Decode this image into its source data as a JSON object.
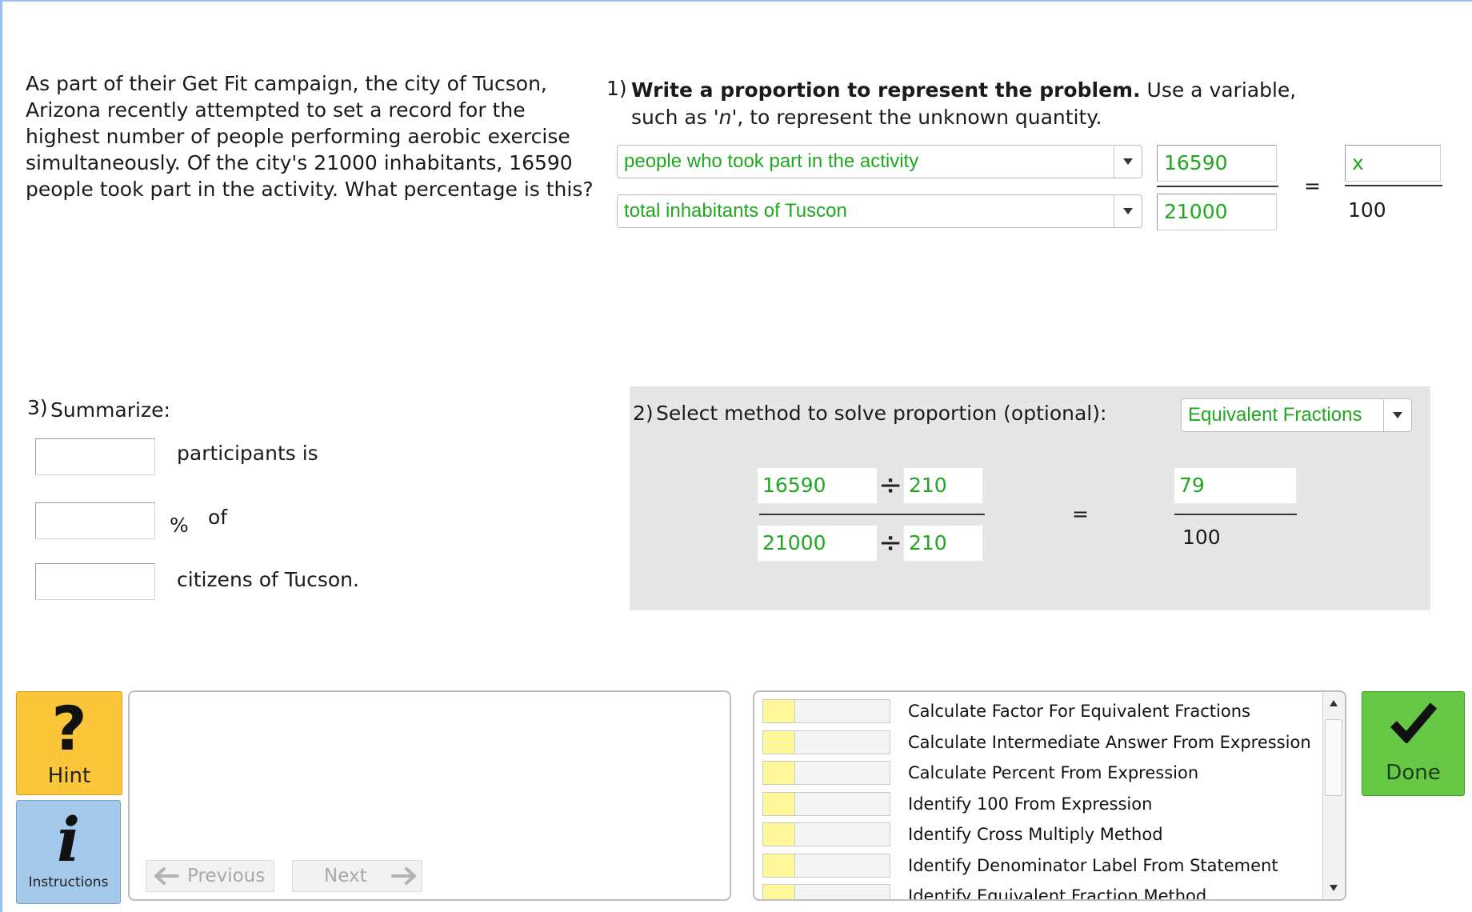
{
  "problem": {
    "text": "As part of their Get Fit campaign, the city of Tucson, Arizona recently attempted to set a record for the highest number of people performing aerobic exercise simultaneously. Of the city's 21000 inhabitants, 16590 people took part in the activity. What percentage is this?"
  },
  "step1": {
    "number": "1)",
    "bold": "Write a proportion to represent the problem.",
    "rest_before": " Use a variable, such as '",
    "variable": "n",
    "rest_after": "', to represent the unknown quantity.",
    "top_label": "people who took part in the activity",
    "bottom_label": "total inhabitants of Tuscon",
    "top_value": "16590",
    "bottom_value": "21000",
    "equals": "=",
    "unknown_value": "x",
    "denominator": "100"
  },
  "step2": {
    "number": "2)",
    "label": "Select method to solve proportion (optional):",
    "method": "Equivalent Fractions",
    "top_value": "16590",
    "top_divisor": "210",
    "bottom_value": "21000",
    "bottom_divisor": "210",
    "divide_sign": "÷",
    "equals": "=",
    "result_numerator": "79",
    "result_denominator": "100"
  },
  "step3": {
    "number": "3)",
    "label": "Summarize:",
    "line1": "participants is",
    "percent_sign": "%",
    "line2": "of",
    "line3": "citizens of Tucson."
  },
  "buttons": {
    "hint": "Hint",
    "hint_glyph": "?",
    "instructions": "Instructions",
    "instructions_glyph": "i",
    "previous": "Previous",
    "next": "Next",
    "done": "Done"
  },
  "skills": [
    {
      "label": "Calculate Factor For Equivalent Fractions",
      "mastery": 0.25
    },
    {
      "label": "Calculate Intermediate Answer From Expression",
      "mastery": 0.25
    },
    {
      "label": "Calculate Percent From Expression",
      "mastery": 0.25
    },
    {
      "label": "Identify 100 From Expression",
      "mastery": 0.25
    },
    {
      "label": "Identify Cross Multiply Method",
      "mastery": 0.25
    },
    {
      "label": "Identify Denominator Label From Statement",
      "mastery": 0.25
    },
    {
      "label": "Identify Equivalent Fraction Method",
      "mastery": 0.25
    }
  ],
  "colors": {
    "answer_green": "#1fa81f",
    "hint_yellow": "#fcc63a",
    "instructions_blue": "#a3c8ea",
    "done_green": "#66c845",
    "skill_yellow": "#fff89a"
  },
  "icons": {
    "hint": "question-mark-icon",
    "instructions": "info-icon",
    "previous": "arrow-left-icon",
    "next": "arrow-right-icon",
    "done": "checkmark-icon"
  }
}
